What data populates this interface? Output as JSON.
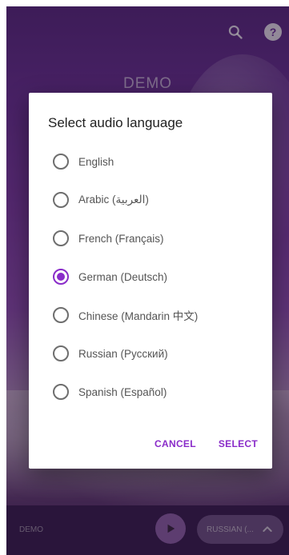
{
  "header": {
    "title": "DEMO"
  },
  "icons": {
    "search": "search-icon",
    "help": "help-icon",
    "help_glyph": "?"
  },
  "dialog": {
    "title": "Select audio language",
    "options": [
      {
        "label": "English",
        "checked": false
      },
      {
        "label": "Arabic (العربية)",
        "checked": false
      },
      {
        "label": "French (Français)",
        "checked": false
      },
      {
        "label": "German (Deutsch)",
        "checked": true
      },
      {
        "label": "Chinese (Mandarin 中文)",
        "checked": false
      },
      {
        "label": "Russian (Русский)",
        "checked": false
      },
      {
        "label": "Spanish (Español)",
        "checked": false
      }
    ],
    "cancel_label": "CANCEL",
    "select_label": "SELECT"
  },
  "bottom_bar": {
    "title": "DEMO",
    "language_pill": "RUSSIAN (...",
    "chevron": "chevron-up-icon"
  },
  "colors": {
    "accent": "#8a2cc9",
    "app_purple": "#6b3296"
  }
}
